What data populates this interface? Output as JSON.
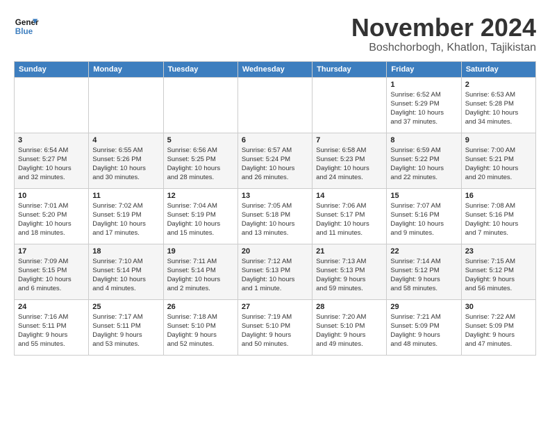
{
  "header": {
    "logo_line1": "General",
    "logo_line2": "Blue",
    "month": "November 2024",
    "location": "Boshchorbogh, Khatlon, Tajikistan"
  },
  "weekdays": [
    "Sunday",
    "Monday",
    "Tuesday",
    "Wednesday",
    "Thursday",
    "Friday",
    "Saturday"
  ],
  "weeks": [
    [
      {
        "day": "",
        "info": ""
      },
      {
        "day": "",
        "info": ""
      },
      {
        "day": "",
        "info": ""
      },
      {
        "day": "",
        "info": ""
      },
      {
        "day": "",
        "info": ""
      },
      {
        "day": "1",
        "info": "Sunrise: 6:52 AM\nSunset: 5:29 PM\nDaylight: 10 hours\nand 37 minutes."
      },
      {
        "day": "2",
        "info": "Sunrise: 6:53 AM\nSunset: 5:28 PM\nDaylight: 10 hours\nand 34 minutes."
      }
    ],
    [
      {
        "day": "3",
        "info": "Sunrise: 6:54 AM\nSunset: 5:27 PM\nDaylight: 10 hours\nand 32 minutes."
      },
      {
        "day": "4",
        "info": "Sunrise: 6:55 AM\nSunset: 5:26 PM\nDaylight: 10 hours\nand 30 minutes."
      },
      {
        "day": "5",
        "info": "Sunrise: 6:56 AM\nSunset: 5:25 PM\nDaylight: 10 hours\nand 28 minutes."
      },
      {
        "day": "6",
        "info": "Sunrise: 6:57 AM\nSunset: 5:24 PM\nDaylight: 10 hours\nand 26 minutes."
      },
      {
        "day": "7",
        "info": "Sunrise: 6:58 AM\nSunset: 5:23 PM\nDaylight: 10 hours\nand 24 minutes."
      },
      {
        "day": "8",
        "info": "Sunrise: 6:59 AM\nSunset: 5:22 PM\nDaylight: 10 hours\nand 22 minutes."
      },
      {
        "day": "9",
        "info": "Sunrise: 7:00 AM\nSunset: 5:21 PM\nDaylight: 10 hours\nand 20 minutes."
      }
    ],
    [
      {
        "day": "10",
        "info": "Sunrise: 7:01 AM\nSunset: 5:20 PM\nDaylight: 10 hours\nand 18 minutes."
      },
      {
        "day": "11",
        "info": "Sunrise: 7:02 AM\nSunset: 5:19 PM\nDaylight: 10 hours\nand 17 minutes."
      },
      {
        "day": "12",
        "info": "Sunrise: 7:04 AM\nSunset: 5:19 PM\nDaylight: 10 hours\nand 15 minutes."
      },
      {
        "day": "13",
        "info": "Sunrise: 7:05 AM\nSunset: 5:18 PM\nDaylight: 10 hours\nand 13 minutes."
      },
      {
        "day": "14",
        "info": "Sunrise: 7:06 AM\nSunset: 5:17 PM\nDaylight: 10 hours\nand 11 minutes."
      },
      {
        "day": "15",
        "info": "Sunrise: 7:07 AM\nSunset: 5:16 PM\nDaylight: 10 hours\nand 9 minutes."
      },
      {
        "day": "16",
        "info": "Sunrise: 7:08 AM\nSunset: 5:16 PM\nDaylight: 10 hours\nand 7 minutes."
      }
    ],
    [
      {
        "day": "17",
        "info": "Sunrise: 7:09 AM\nSunset: 5:15 PM\nDaylight: 10 hours\nand 6 minutes."
      },
      {
        "day": "18",
        "info": "Sunrise: 7:10 AM\nSunset: 5:14 PM\nDaylight: 10 hours\nand 4 minutes."
      },
      {
        "day": "19",
        "info": "Sunrise: 7:11 AM\nSunset: 5:14 PM\nDaylight: 10 hours\nand 2 minutes."
      },
      {
        "day": "20",
        "info": "Sunrise: 7:12 AM\nSunset: 5:13 PM\nDaylight: 10 hours\nand 1 minute."
      },
      {
        "day": "21",
        "info": "Sunrise: 7:13 AM\nSunset: 5:13 PM\nDaylight: 9 hours\nand 59 minutes."
      },
      {
        "day": "22",
        "info": "Sunrise: 7:14 AM\nSunset: 5:12 PM\nDaylight: 9 hours\nand 58 minutes."
      },
      {
        "day": "23",
        "info": "Sunrise: 7:15 AM\nSunset: 5:12 PM\nDaylight: 9 hours\nand 56 minutes."
      }
    ],
    [
      {
        "day": "24",
        "info": "Sunrise: 7:16 AM\nSunset: 5:11 PM\nDaylight: 9 hours\nand 55 minutes."
      },
      {
        "day": "25",
        "info": "Sunrise: 7:17 AM\nSunset: 5:11 PM\nDaylight: 9 hours\nand 53 minutes."
      },
      {
        "day": "26",
        "info": "Sunrise: 7:18 AM\nSunset: 5:10 PM\nDaylight: 9 hours\nand 52 minutes."
      },
      {
        "day": "27",
        "info": "Sunrise: 7:19 AM\nSunset: 5:10 PM\nDaylight: 9 hours\nand 50 minutes."
      },
      {
        "day": "28",
        "info": "Sunrise: 7:20 AM\nSunset: 5:10 PM\nDaylight: 9 hours\nand 49 minutes."
      },
      {
        "day": "29",
        "info": "Sunrise: 7:21 AM\nSunset: 5:09 PM\nDaylight: 9 hours\nand 48 minutes."
      },
      {
        "day": "30",
        "info": "Sunrise: 7:22 AM\nSunset: 5:09 PM\nDaylight: 9 hours\nand 47 minutes."
      }
    ]
  ]
}
